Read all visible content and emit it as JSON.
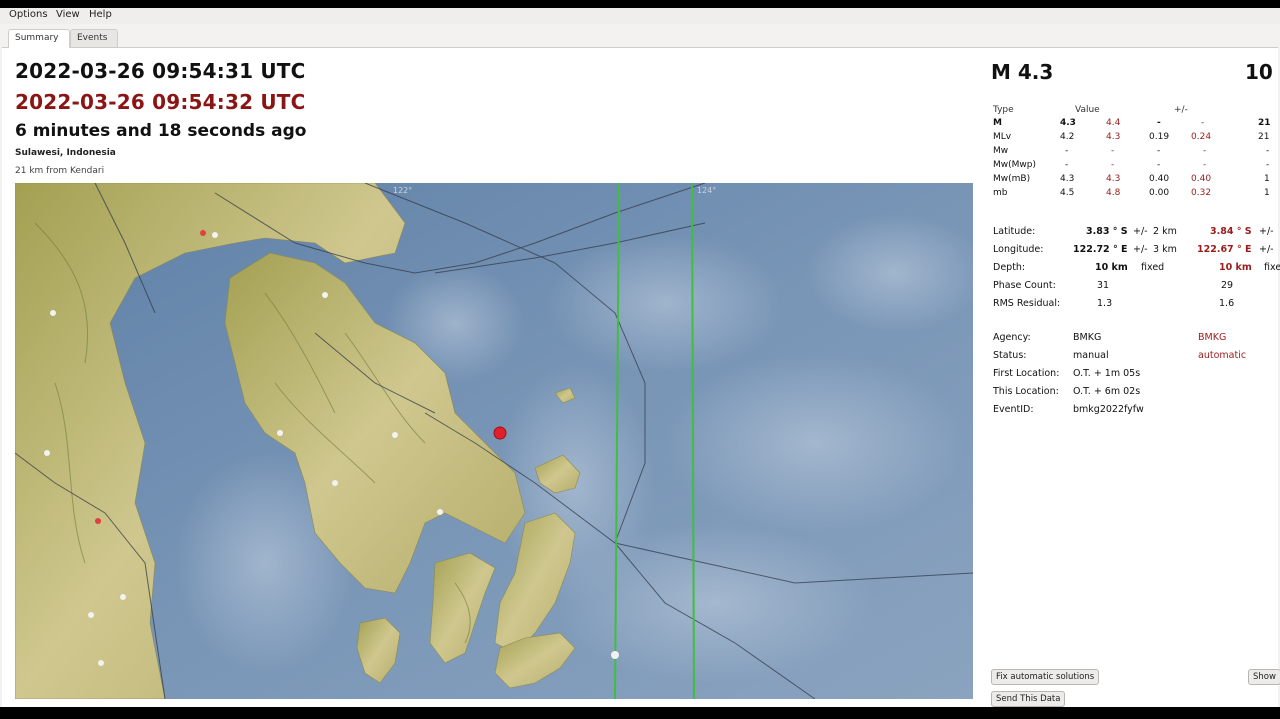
{
  "menubar": {
    "options": "Options",
    "view": "View",
    "help": "Help"
  },
  "tabs": [
    {
      "label": "Summary",
      "active": true
    },
    {
      "label": "Events",
      "active": false
    }
  ],
  "summary": {
    "origin_time": "2022-03-26 09:54:31 UTC",
    "origin_time_automatic": "2022-03-26 09:54:32 UTC",
    "elapsed": "6 minutes and 18 seconds ago",
    "region": "Sulawesi, Indonesia",
    "distance": "21 km from Kendari"
  },
  "map": {
    "lon_labels": [
      "122°",
      "124°"
    ],
    "colors": {
      "sea": "#6f8db0",
      "land": "#c8c28a",
      "epicenter": "#e0202a",
      "meridian": "#3fbf3f"
    }
  },
  "magnitude": {
    "title": "M 4.3",
    "count": "10",
    "headers": {
      "type": "Type",
      "value": "Value",
      "pm": "+/-"
    },
    "rows": [
      {
        "type": "M",
        "value": "4.3",
        "value_auto": "4.4",
        "err": "-",
        "err_auto": "-",
        "count": "21"
      },
      {
        "type": "MLv",
        "value": "4.2",
        "value_auto": "4.3",
        "err": "0.19",
        "err_auto": "0.24",
        "count": "21"
      },
      {
        "type": "Mw",
        "value": "-",
        "value_auto": "-",
        "err": "-",
        "err_auto": "-",
        "count": "-"
      },
      {
        "type": "Mw(Mwp)",
        "value": "-",
        "value_auto": "-",
        "err": "-",
        "err_auto": "-",
        "count": "-"
      },
      {
        "type": "Mw(mB)",
        "value": "4.3",
        "value_auto": "4.3",
        "err": "0.40",
        "err_auto": "0.40",
        "count": "1"
      },
      {
        "type": "mb",
        "value": "4.5",
        "value_auto": "4.8",
        "err": "0.00",
        "err_auto": "0.32",
        "count": "1"
      }
    ]
  },
  "origin": {
    "latitude": {
      "label": "Latitude:",
      "value": "3.83 ° S",
      "pm": "+/-",
      "err": "2 km",
      "value_auto": "3.84 ° S",
      "pm_auto": "+/-"
    },
    "longitude": {
      "label": "Longitude:",
      "value": "122.72 ° E",
      "pm": "+/-",
      "err": "3 km",
      "value_auto": "122.67 ° E",
      "pm_auto": "+/-"
    },
    "depth": {
      "label": "Depth:",
      "value": "10 km",
      "note": "fixed",
      "value_auto": "10 km",
      "note_auto": "fixed"
    },
    "phase_count": {
      "label": "Phase Count:",
      "value": "31",
      "value_auto": "29"
    },
    "rms": {
      "label": "RMS Residual:",
      "value": "1.3",
      "value_auto": "1.6"
    }
  },
  "meta": {
    "agency": {
      "label": "Agency:",
      "value": "BMKG",
      "value_auto": "BMKG"
    },
    "status": {
      "label": "Status:",
      "value": "manual",
      "value_auto": "automatic"
    },
    "first_location": {
      "label": "First Location:",
      "value": "O.T. + 1m 05s"
    },
    "this_location": {
      "label": "This Location:",
      "value": "O.T. + 6m 02s"
    },
    "event_id": {
      "label": "EventID:",
      "value": "bmkg2022fyfw"
    }
  },
  "buttons": {
    "fix": "Fix automatic solutions",
    "send": "Send This Data",
    "show": "Show"
  }
}
